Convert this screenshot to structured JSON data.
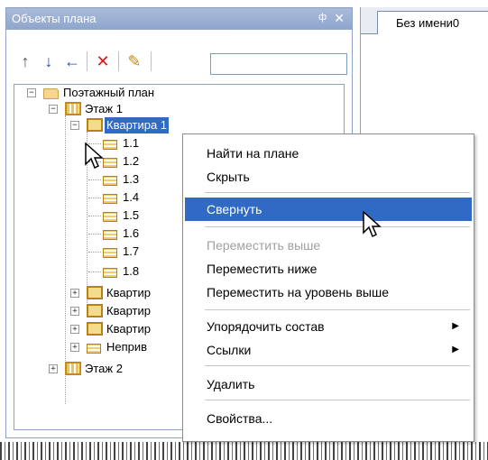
{
  "panel": {
    "title": "Объекты плана",
    "pin_glyph": "ф",
    "close_glyph": "✕"
  },
  "toolbar": {
    "buttons": [
      {
        "icon": "arrow-up-icon",
        "glyph": "↑",
        "color": "#555555"
      },
      {
        "icon": "arrow-down-icon",
        "glyph": "↓",
        "color": "#1f4fbf"
      },
      {
        "icon": "arrow-left-icon",
        "glyph": "←",
        "color": "#1f4fbf"
      },
      {
        "icon": "delete-icon",
        "glyph": "✕",
        "color": "#d41b1b"
      },
      {
        "icon": "properties-icon",
        "glyph": "✎",
        "color": "#c98a10"
      }
    ],
    "search_value": ""
  },
  "tree": {
    "root": "Поэтажный план",
    "floor1": "Этаж 1",
    "apartment1": "Квартира 1",
    "rooms": [
      "1.1",
      "1.2",
      "1.3",
      "1.4",
      "1.5",
      "1.6",
      "1.7",
      "1.8"
    ],
    "collapsed_items": [
      "Квартир",
      "Квартир",
      "Квартир",
      "Неприв"
    ],
    "floor2": "Этаж 2"
  },
  "document": {
    "tab_label": "Без имени0"
  },
  "context_menu": {
    "items": [
      {
        "label": "Найти на плане",
        "state": "normal"
      },
      {
        "label": "Скрыть",
        "state": "normal"
      },
      {
        "label": "Свернуть",
        "state": "highlighted"
      },
      {
        "label": "Переместить выше",
        "state": "disabled"
      },
      {
        "label": "Переместить ниже",
        "state": "normal"
      },
      {
        "label": "Переместить на уровень выше",
        "state": "normal"
      },
      {
        "label": "Упорядочить состав",
        "state": "submenu"
      },
      {
        "label": "Ссылки",
        "state": "submenu"
      },
      {
        "label": "Удалить",
        "state": "normal"
      },
      {
        "label": "Свойства...",
        "state": "normal"
      }
    ],
    "highlight_color": "#316ac5"
  },
  "colors": {
    "title_bar": "#8ea5cc",
    "selection": "#316ac5"
  }
}
